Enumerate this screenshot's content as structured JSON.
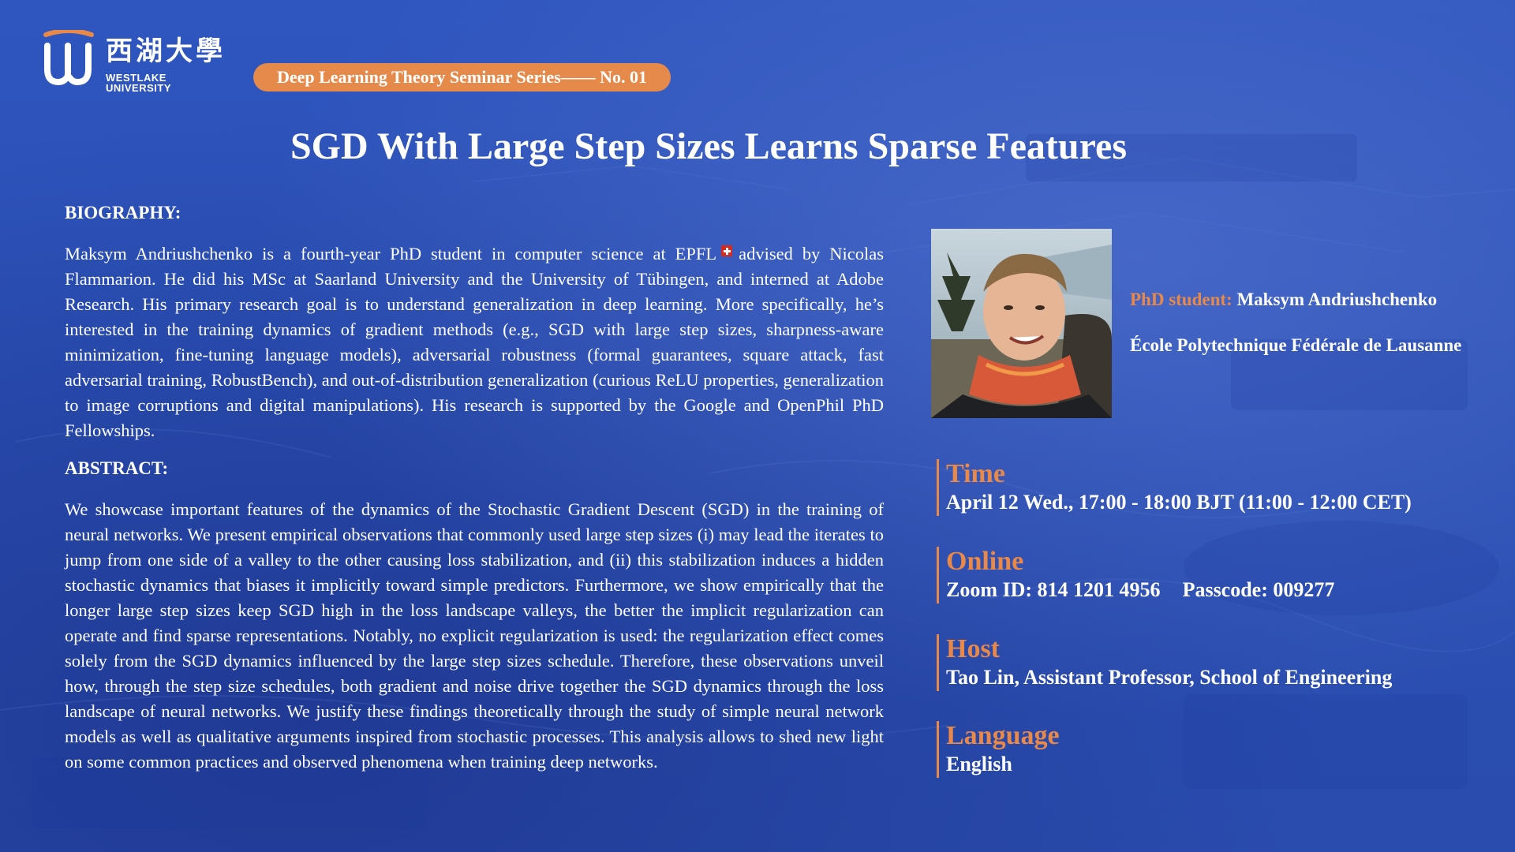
{
  "brand": {
    "name_cn": "西湖大學",
    "name_en": "WESTLAKE UNIVERSITY",
    "colors": {
      "accent": "#e8894a",
      "background": "#2c51b8",
      "text": "#ffffff"
    }
  },
  "series_badge": "Deep Learning Theory Seminar Series—— No. 01",
  "title": "SGD With Large Step Sizes Learns Sparse Features",
  "biography": {
    "heading": "BIOGRAPHY:",
    "text_before_flag": "Maksym Andriushchenko is a fourth-year PhD student in computer science at EPFL",
    "flag_icon": "swiss-flag-icon",
    "text_after_flag": "advised by Nicolas Flammarion. He did his MSc at Saarland University and the University of Tübingen, and interned at Adobe Research. His primary research goal is to understand generalization in deep learning. More specifically, he’s interested in the training dynamics of gradient methods (e.g., SGD with large step sizes, sharpness-aware minimization, fine-tuning language models), adversarial robustness (formal guarantees, square attack, fast adversarial training, RobustBench), and out-of-distribution generalization (curious ReLU properties, generalization to image corruptions and digital manipulations). His research is supported by the Google and OpenPhil PhD Fellowships."
  },
  "abstract": {
    "heading": "ABSTRACT:",
    "text": "We showcase important features of the dynamics of the Stochastic Gradient Descent (SGD) in the training of neural networks. We present empirical observations that commonly used large step sizes (i) may lead the iterates to jump from one side of a valley to the other causing loss stabilization, and (ii) this stabilization induces a hidden stochastic dynamics that biases it implicitly toward simple predictors. Furthermore, we show empirically that the longer large step sizes keep SGD high in the loss landscape valleys, the better the implicit regularization can operate and find sparse representations. Notably, no explicit regularization is used: the regularization effect comes solely from the SGD dynamics influenced by the large step sizes schedule. Therefore, these observations unveil how, through the step size schedules, both gradient and noise drive together the SGD dynamics through the loss landscape of neural networks. We justify these findings theoretically through the study of simple neural network models as well as qualitative arguments inspired from stochastic processes. This analysis allows to shed new light on some common practices and observed phenomena when training deep networks."
  },
  "speaker": {
    "role_label": "PhD student:",
    "name": "Maksym Andriushchenko",
    "affiliation": "École Polytechnique Fédérale de Lausanne"
  },
  "details": {
    "time_label": "Time",
    "time_value": "April 12 Wed., 17:00 - 18:00 BJT (11:00 - 12:00 CET)",
    "online_label": "Online",
    "zoom_id": "Zoom ID: 814 1201 4956",
    "passcode": "Passcode: 009277",
    "host_label": "Host",
    "host_value": "Tao Lin, Assistant Professor, School of Engineering",
    "language_label": "Language",
    "language_value": "English"
  }
}
